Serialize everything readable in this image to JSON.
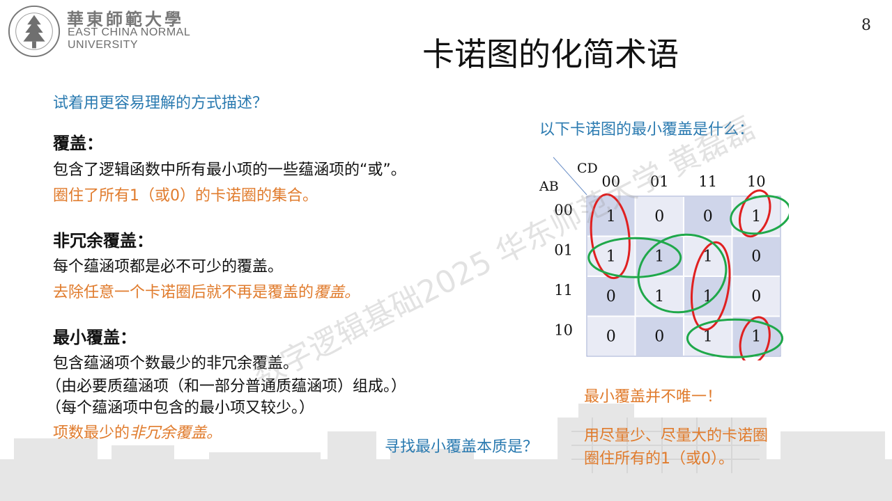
{
  "header": {
    "logo_cn": "華東師範大學",
    "logo_en_line1": "EAST CHINA NORMAL",
    "logo_en_line2": "UNIVERSITY",
    "page_number": "8"
  },
  "title": "卡诺图的化简术语",
  "left": {
    "intro": "试着用更容易理解的方式描述？",
    "cover_heading": "覆盖：",
    "cover_def": "包含了逻辑函数中所有最小项的一些蕴涵项的“或”。",
    "cover_simple": "圈住了所有1（或0）的卡诺圈的集合。",
    "nonredundant_heading": "非冗余覆盖：",
    "nonredundant_def": "每个蕴涵项都是必不可少的覆盖。",
    "nonredundant_simple_prefix": "去除任意一个卡诺圈后就不再是覆盖的",
    "nonredundant_simple_italic": "覆盖。",
    "minimal_heading": "最小覆盖：",
    "minimal_def": "包含蕴涵项个数最少的非冗余覆盖。",
    "minimal_note1": "（由必要质蕴涵项（和一部分普通质蕴涵项）组成。）",
    "minimal_note2": "（每个蕴涵项中包含的最小项又较少。）",
    "minimal_simple_prefix": "项数最少的",
    "minimal_simple_italic": "非冗余覆盖。"
  },
  "right": {
    "question": "以下卡诺图的最小覆盖是什么：",
    "not_unique": "最小覆盖并不唯一！",
    "essence_question": "寻找最小覆盖本质是？",
    "answer_line1": "用尽量少、尽量大的卡诺圈",
    "answer_line2": "圈住所有的1（或0）。"
  },
  "kmap": {
    "col_var": "CD",
    "row_var": "AB",
    "col_labels": [
      "00",
      "01",
      "11",
      "10"
    ],
    "row_labels": [
      "00",
      "01",
      "11",
      "10"
    ],
    "cells": [
      [
        "1",
        "0",
        "0",
        "1"
      ],
      [
        "1",
        "1",
        "1",
        "0"
      ],
      [
        "0",
        "1",
        "1",
        "0"
      ],
      [
        "0",
        "0",
        "1",
        "1"
      ]
    ],
    "colors": {
      "cell_dark": "#cfd5ea",
      "cell_light": "#e9ebf5",
      "red_loop": "#e02020",
      "green_loop": "#1fa84a"
    }
  },
  "watermark": "数字逻辑基础2025 华东师范大学 黄磊磊"
}
